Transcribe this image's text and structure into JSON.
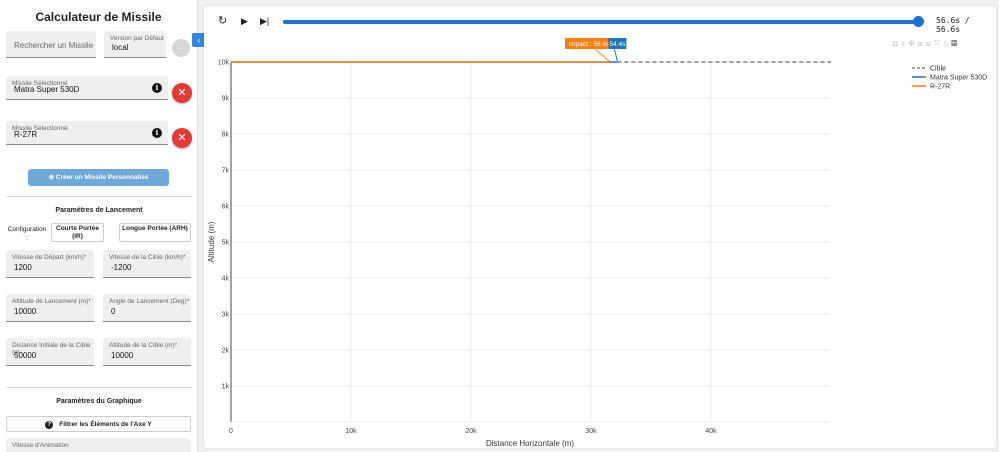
{
  "sidebar": {
    "title": "Calculateur de Missile",
    "search_placeholder": "Rechercher un Missile",
    "version_label": "Version par Défaut",
    "version_value": "local",
    "missile1_label": "Missile Sélectionné",
    "missile1_value": "Matra Super 530D",
    "missile2_label": "Missile Sélectionné",
    "missile2_value": "R-27R",
    "create_button": "Créer un Missile Personnalisé",
    "launch_params_title": "Paramètres de Lancement",
    "config_label": "Configuration :",
    "config_short": "Courte Portée (IR)",
    "config_long": "Longue Portée (ARH)",
    "fields": {
      "launch_speed": {
        "label": "Vitesse de Départ (km/h)*",
        "value": "1200"
      },
      "target_speed": {
        "label": "Vitesse de la Cible (km/h)*",
        "value": "-1200"
      },
      "launch_alt": {
        "label": "Altitude de Lancement (m)*",
        "value": "10000"
      },
      "launch_angle": {
        "label": "Angle de Lancement (Deg)*",
        "value": "0"
      },
      "target_dist": {
        "label": "Distance Initiale de la Cible (m",
        "value": "50000"
      },
      "target_alt": {
        "label": "Altitude de la Cible (m)*",
        "value": "10000"
      }
    },
    "graph_params_title": "Paramètres du Graphique",
    "filter_button": "Filtrer les Éléments de l'Axe Y",
    "anim_speed_label": "Vitesse d'Animation"
  },
  "player": {
    "time_display": "56.6s / 56.6s",
    "progress": 1.0
  },
  "chart_data": {
    "type": "line",
    "xlabel": "Distance Horizontale (m)",
    "ylabel": "Altitude (m)",
    "xlim": [
      0,
      50000
    ],
    "ylim": [
      0,
      10000
    ],
    "x_ticks": [
      0,
      10000,
      20000,
      30000,
      40000
    ],
    "x_tick_labels": [
      "0",
      "10k",
      "20k",
      "30k",
      "40k"
    ],
    "y_ticks": [
      1000,
      2000,
      3000,
      4000,
      5000,
      6000,
      7000,
      8000,
      9000,
      10000
    ],
    "y_tick_labels": [
      "1k",
      "2k",
      "3k",
      "4k",
      "5k",
      "6k",
      "7k",
      "8k",
      "9k",
      "10k"
    ],
    "grid": true,
    "legend_position": "top-right",
    "series": [
      {
        "name": "Cible",
        "dash": true,
        "color": "#7f7f7f",
        "x": [
          32200,
          50000
        ],
        "y": [
          10000,
          10000
        ]
      },
      {
        "name": "Matra Super 530D",
        "dash": false,
        "color": "#1f77b4",
        "x": [
          0,
          32200
        ],
        "y": [
          10000,
          10000
        ]
      },
      {
        "name": "R-27R",
        "dash": false,
        "color": "#ff7f0e",
        "x": [
          0,
          31500
        ],
        "y": [
          10000,
          10000
        ]
      }
    ],
    "annotations": [
      {
        "text": "Impact : 56.6s",
        "color": "#ff7f0e",
        "x": 31500,
        "y": 10000
      },
      {
        "text": "54.4s",
        "color": "#1f77b4",
        "x": 32200,
        "y": 10000
      }
    ]
  }
}
